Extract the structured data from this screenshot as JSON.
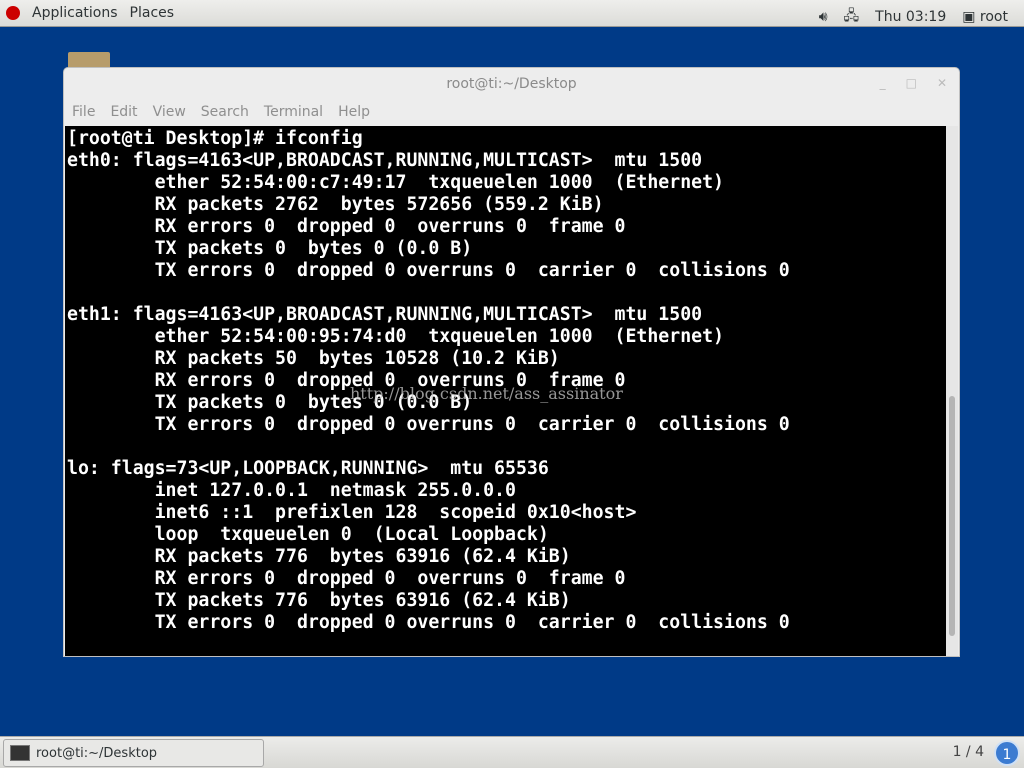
{
  "topbar": {
    "applications": "Applications",
    "places": "Places",
    "clock": "Thu 03:19",
    "user": "root"
  },
  "window": {
    "title": "root@ti:~/Desktop",
    "menu": [
      "File",
      "Edit",
      "View",
      "Search",
      "Terminal",
      "Help"
    ],
    "terminal_text": "[root@ti Desktop]# ifconfig\neth0: flags=4163<UP,BROADCAST,RUNNING,MULTICAST>  mtu 1500\n        ether 52:54:00:c7:49:17  txqueuelen 1000  (Ethernet)\n        RX packets 2762  bytes 572656 (559.2 KiB)\n        RX errors 0  dropped 0  overruns 0  frame 0\n        TX packets 0  bytes 0 (0.0 B)\n        TX errors 0  dropped 0 overruns 0  carrier 0  collisions 0\n\neth1: flags=4163<UP,BROADCAST,RUNNING,MULTICAST>  mtu 1500\n        ether 52:54:00:95:74:d0  txqueuelen 1000  (Ethernet)\n        RX packets 50  bytes 10528 (10.2 KiB)\n        RX errors 0  dropped 0  overruns 0  frame 0\n        TX packets 0  bytes 0 (0.0 B)\n        TX errors 0  dropped 0 overruns 0  carrier 0  collisions 0\n\nlo: flags=73<UP,LOOPBACK,RUNNING>  mtu 65536\n        inet 127.0.0.1  netmask 255.0.0.0\n        inet6 ::1  prefixlen 128  scopeid 0x10<host>\n        loop  txqueuelen 0  (Local Loopback)\n        RX packets 776  bytes 63916 (62.4 KiB)\n        RX errors 0  dropped 0  overruns 0  frame 0\n        TX packets 776  bytes 63916 (62.4 KiB)\n        TX errors 0  dropped 0 overruns 0  carrier 0  collisions 0",
    "watermark": "http://blog.csdn.net/ass_assinator"
  },
  "taskbar": {
    "task": "root@ti:~/Desktop",
    "pager": "1 / 4",
    "workspace": "1"
  }
}
